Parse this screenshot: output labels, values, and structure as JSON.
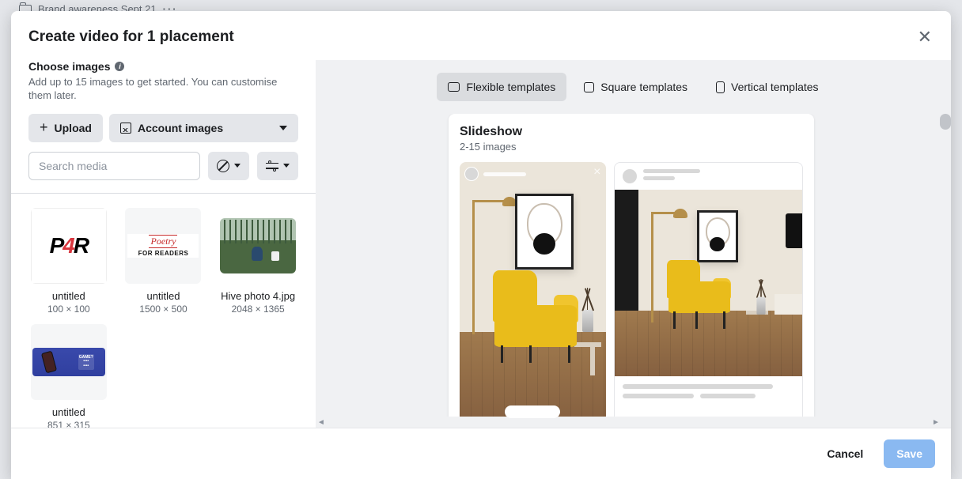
{
  "background_hint": {
    "folder_label": "Brand awareness Sept 21"
  },
  "modal": {
    "title": "Create video for 1 placement",
    "choose_images": {
      "heading": "Choose images",
      "description": "Add up to 15 images to get started. You can customise them later.",
      "upload_label": "Upload",
      "account_images_label": "Account images",
      "search_placeholder": "Search media"
    },
    "media": [
      {
        "name": "untitled",
        "dims": "100 × 100"
      },
      {
        "name": "untitled",
        "dims": "1500 × 500"
      },
      {
        "name": "Hive photo 4.jpg",
        "dims": "2048 × 1365"
      },
      {
        "name": "untitled",
        "dims": "851 × 315"
      }
    ],
    "tabs": {
      "flexible": "Flexible templates",
      "square": "Square templates",
      "vertical": "Vertical templates",
      "active": "flexible"
    },
    "template_card": {
      "title": "Slideshow",
      "subtitle": "2-15 images"
    },
    "footer": {
      "cancel": "Cancel",
      "save": "Save"
    }
  }
}
